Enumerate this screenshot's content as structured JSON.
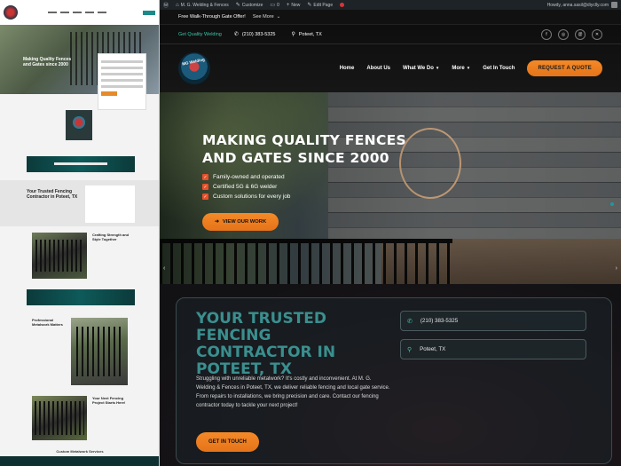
{
  "admin_bar": {
    "site_name": "M. G. Welding & Fences",
    "customize": "Customize",
    "comments_count": "0",
    "new": "New",
    "edit_page": "Edit Page",
    "updates_count": "2",
    "greeting": "Howdy, anna.sasil@diyclly.com"
  },
  "announcement": {
    "text": "Free Walk-Through Gate Offer!",
    "see_more": "See More"
  },
  "header": {
    "tagline": "Get Quality Welding",
    "phone": "(210) 383-5325",
    "location": "Poteet, TX",
    "logo_text": "MG Welding",
    "nav": [
      {
        "label": "Home",
        "has_caret": false
      },
      {
        "label": "About Us",
        "has_caret": false
      },
      {
        "label": "What We Do",
        "has_caret": true
      },
      {
        "label": "More",
        "has_caret": true
      },
      {
        "label": "Get In Touch",
        "has_caret": false
      }
    ],
    "quote_button": "REQUEST A QUOTE",
    "social_icons": [
      "facebook-icon",
      "instagram-icon",
      "threads-icon",
      "x-icon"
    ]
  },
  "hero": {
    "title_line1": "MAKING QUALITY FENCES",
    "title_line2": "AND GATES SINCE 2000",
    "features": [
      "Family-owned and operated",
      "Certified 5G & 6G welder",
      "Custom solutions for every job"
    ],
    "button": "VIEW OUR WORK"
  },
  "trusted": {
    "title": "YOUR TRUSTED FENCING CONTRACTOR IN POTEET, TX",
    "body": "Struggling with unreliable metalwork? It's costly and inconvenient. At M. G. Welding & Fences in Poteet, TX, we deliver reliable fencing and local gate service. From repairs to installations, we bring precision and care. Contact our fencing contractor today to tackle your next project!",
    "button": "GET IN TOUCH",
    "phone": "(210) 383-5325",
    "location": "Poteet, TX"
  },
  "preview": {
    "hero_title": "Making Quality Fences and Gates since 2000",
    "trusted_title": "Your Trusted Fencing Contractor in Poteet, TX",
    "section1_title": "Crafting Strength and Style Together",
    "section2_title": "Professional Metalwork Matters",
    "section3_title": "Your Next Fencing Project Starts Here!",
    "footer_title": "Custom Metalwork Services"
  },
  "colors": {
    "accent_orange": "#f48a28",
    "teal": "#3a8f8f",
    "admin_bg": "#1d2327"
  }
}
